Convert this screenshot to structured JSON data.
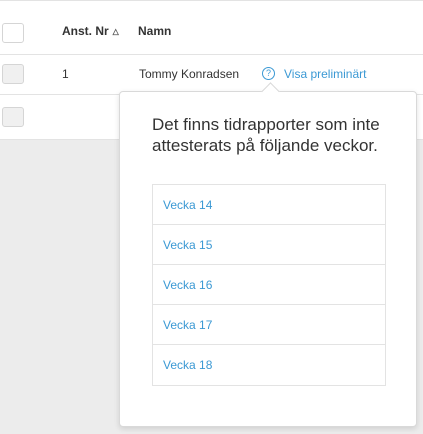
{
  "table": {
    "columns": {
      "employee_no": "Anst. Nr",
      "name": "Namn"
    },
    "sort_icon": "sort-ascending-icon",
    "rows": [
      {
        "employee_no": "1",
        "name": "Tommy Konradsen",
        "help_icon_glyph": "?",
        "preview_link": "Visa preliminärt"
      }
    ]
  },
  "popover": {
    "title": "Det finns tidrapporter som inte attesterats på följande veckor.",
    "weeks": [
      "Vecka 14",
      "Vecka 15",
      "Vecka 16",
      "Vecka 17",
      "Vecka 18"
    ]
  },
  "colors": {
    "link": "#3b99d4",
    "text": "#333333",
    "background_overlay": "#ececec"
  }
}
